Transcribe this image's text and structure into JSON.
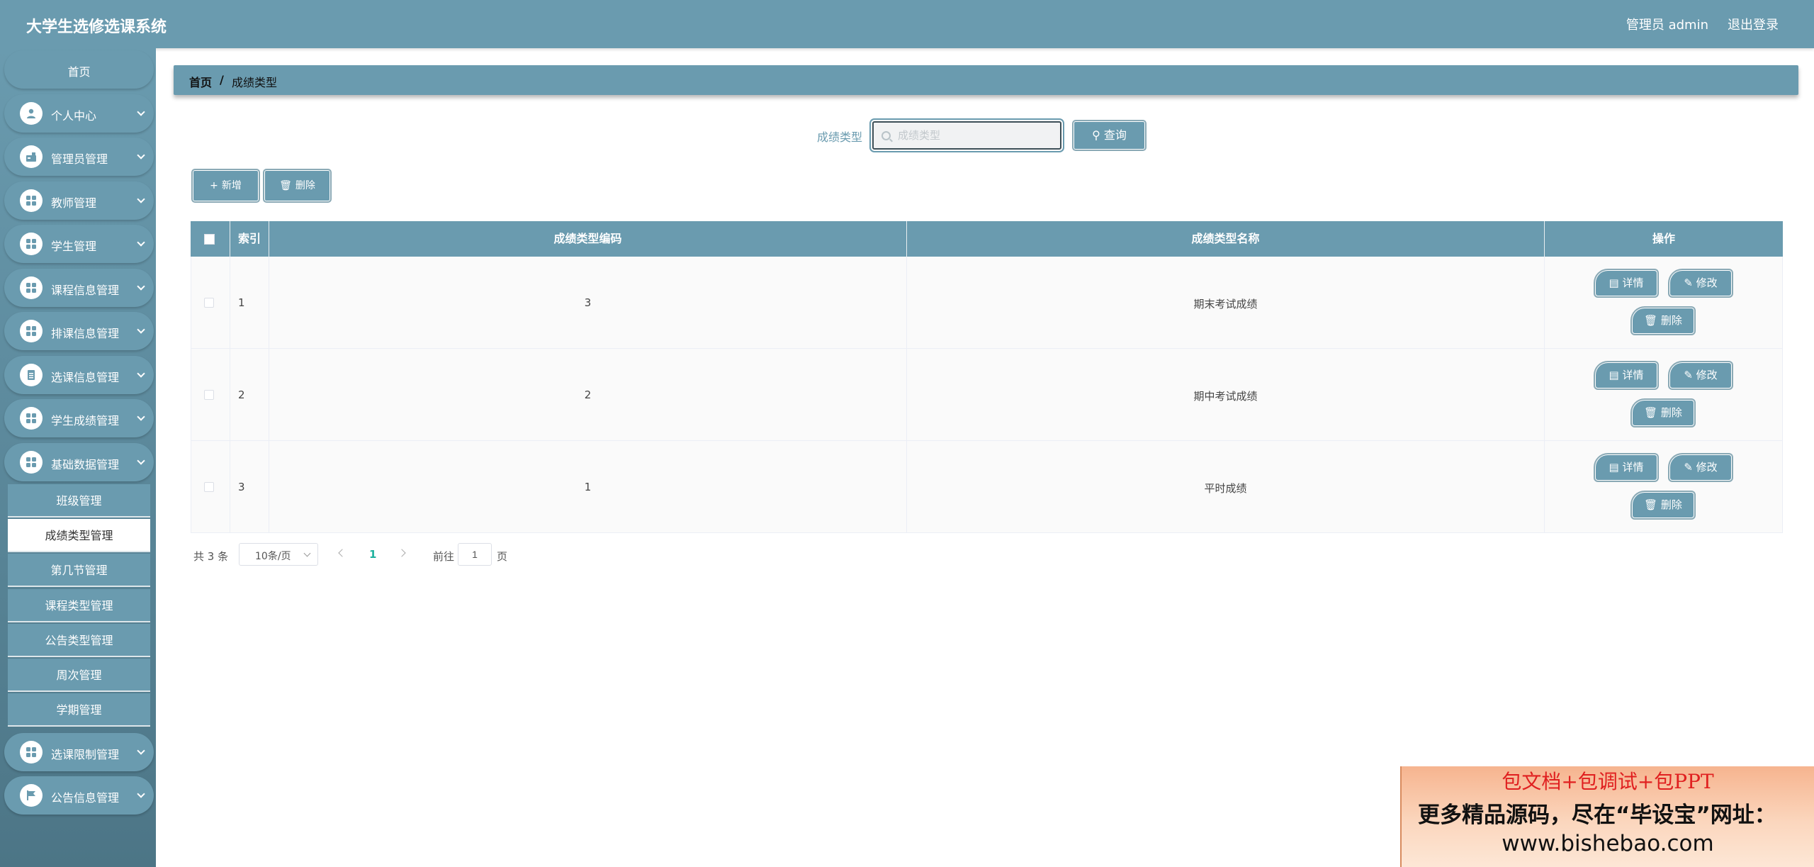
{
  "app": {
    "title": "大学生选修选课系统",
    "admin_label": "管理员 admin",
    "logout_label": "退出登录"
  },
  "sidebar": {
    "home": "首页",
    "menus": [
      {
        "label": "个人中心",
        "icon": "user-icon"
      },
      {
        "label": "管理员管理",
        "icon": "admin-icon"
      },
      {
        "label": "教师管理",
        "icon": "grid-icon"
      },
      {
        "label": "学生管理",
        "icon": "grid-icon"
      },
      {
        "label": "课程信息管理",
        "icon": "grid-icon"
      },
      {
        "label": "排课信息管理",
        "icon": "grid-icon"
      },
      {
        "label": "选课信息管理",
        "icon": "document-icon"
      },
      {
        "label": "学生成绩管理",
        "icon": "grid-icon"
      },
      {
        "label": "基础数据管理",
        "icon": "grid-icon"
      }
    ],
    "submenu": [
      "班级管理",
      "成绩类型管理",
      "第几节管理",
      "课程类型管理",
      "公告类型管理",
      "周次管理",
      "学期管理"
    ],
    "active_submenu": "成绩类型管理",
    "menus_after": [
      {
        "label": "选课限制管理",
        "icon": "grid-icon"
      },
      {
        "label": "公告信息管理",
        "icon": "flag-icon"
      }
    ]
  },
  "breadcrumb": {
    "home": "首页",
    "separator": "/",
    "current": "成绩类型"
  },
  "search": {
    "label": "成绩类型",
    "placeholder": "成绩类型",
    "value": "",
    "button_label": "查询"
  },
  "actions": {
    "add_label": "新增",
    "delete_label": "删除"
  },
  "table": {
    "headers": [
      "索引",
      "成绩类型编码",
      "成绩类型名称",
      "操作"
    ],
    "rows": [
      {
        "index": "1",
        "code": "3",
        "name": "期末考试成绩"
      },
      {
        "index": "2",
        "code": "2",
        "name": "期中考试成绩"
      },
      {
        "index": "3",
        "code": "1",
        "name": "平时成绩"
      }
    ],
    "row_actions": {
      "detail": "详情",
      "edit": "修改",
      "delete": "删除"
    }
  },
  "pagination": {
    "total_text": "共 3 条",
    "page_size": "10条/页",
    "current_page": "1",
    "goto_label": "前往",
    "goto_value": "1",
    "goto_suffix": "页"
  },
  "watermark": {
    "line1": "包文档+包调试+包PPT",
    "line2": "更多精品源码，尽在“毕设宝”网址：",
    "line3": "www.bishebao.com"
  },
  "colors": {
    "primary": "#6a9baf",
    "active_page": "#1fb19e",
    "watermark_red": "#e02020"
  }
}
